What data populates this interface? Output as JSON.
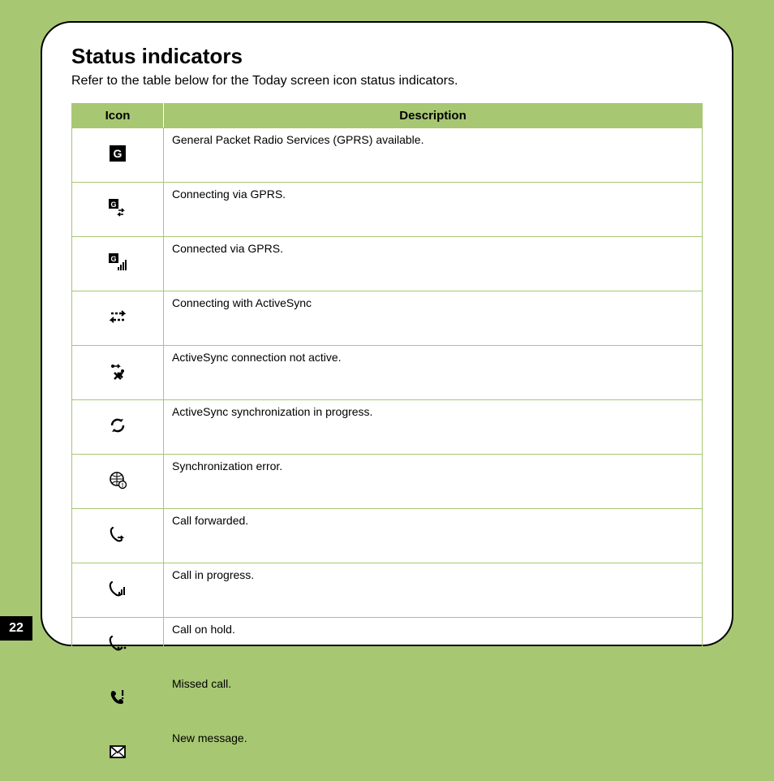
{
  "page_number": "22",
  "heading": "Status indicators",
  "subheading": "Refer to the table below for the Today screen icon status indicators.",
  "table": {
    "headers": {
      "icon": "Icon",
      "description": "Description"
    },
    "rows": [
      {
        "icon_name": "gprs-available-icon",
        "description": "General Packet Radio Services (GPRS) available."
      },
      {
        "icon_name": "gprs-connecting-icon",
        "description": "Connecting via GPRS."
      },
      {
        "icon_name": "gprs-connected-icon",
        "description": "Connected via GPRS."
      },
      {
        "icon_name": "activesync-connecting-icon",
        "description": "Connecting with ActiveSync"
      },
      {
        "icon_name": "activesync-inactive-icon",
        "description": "ActiveSync connection not active."
      },
      {
        "icon_name": "activesync-sync-icon",
        "description": "ActiveSync synchronization in progress."
      },
      {
        "icon_name": "sync-error-icon",
        "description": "Synchronization error."
      },
      {
        "icon_name": "call-forwarded-icon",
        "description": "Call forwarded."
      },
      {
        "icon_name": "call-in-progress-icon",
        "description": "Call in progress."
      },
      {
        "icon_name": "call-on-hold-icon",
        "description": "Call on hold."
      },
      {
        "icon_name": "missed-call-icon",
        "description": "Missed call."
      },
      {
        "icon_name": "new-message-icon",
        "description": "New message."
      }
    ]
  }
}
